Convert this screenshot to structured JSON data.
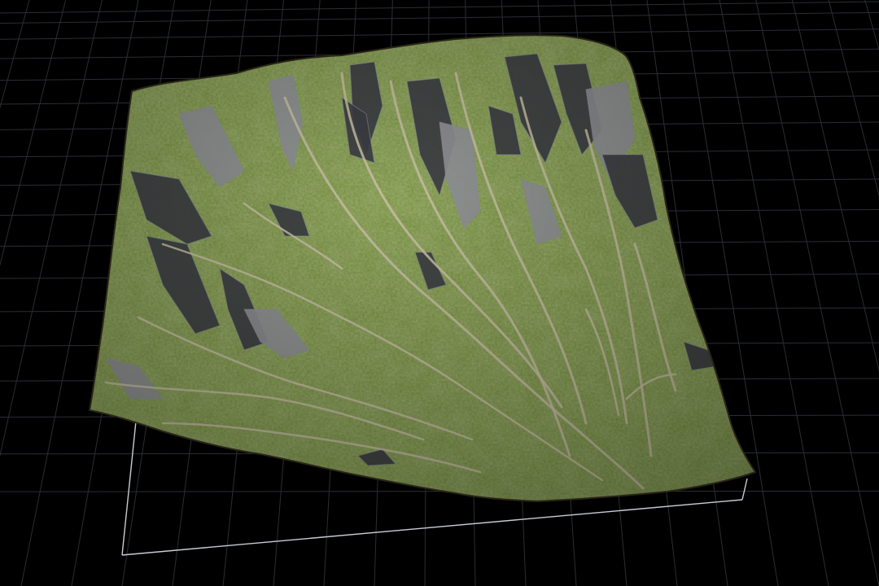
{
  "viewport": {
    "background_color": "#000000",
    "grid_color": "#2a2d33",
    "bounds_color": "#c8ccd2"
  },
  "terrain": {
    "grass_color": "#6f8a3a",
    "grass_dark_color": "#3f5622",
    "grass_light_color": "#9bb35a",
    "rock_color": "#3b3d42",
    "rock_light_color": "#8e9095",
    "path_color": "#c9c0a6",
    "edge_color": "#2a2418"
  }
}
